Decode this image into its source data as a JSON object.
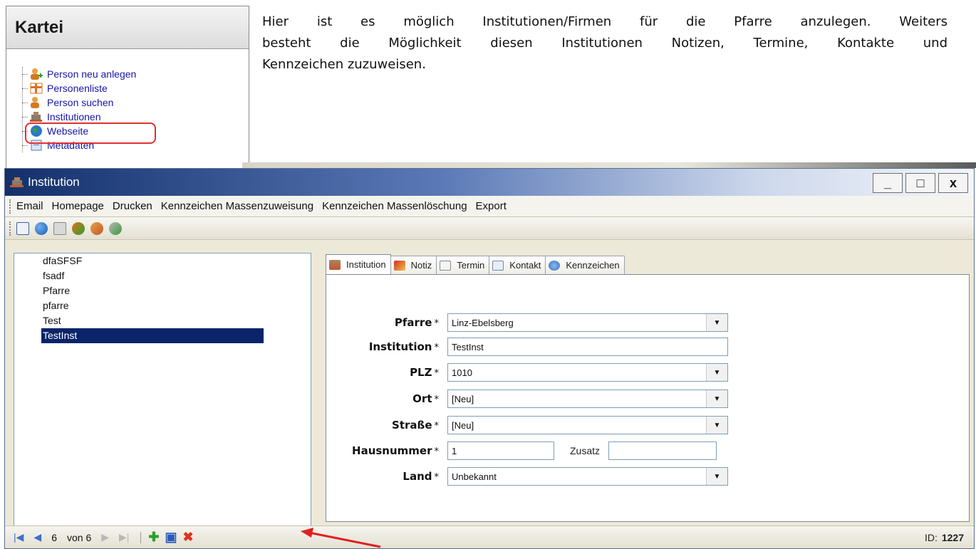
{
  "sidebar": {
    "title": "Kartei",
    "items": [
      {
        "label": "Person neu anlegen",
        "icon": "person-add-icon"
      },
      {
        "label": "Personenliste",
        "icon": "list-icon"
      },
      {
        "label": "Person suchen",
        "icon": "person-search-icon"
      },
      {
        "label": "Institutionen",
        "icon": "institution-icon"
      },
      {
        "label": "Webseite",
        "icon": "globe-icon"
      },
      {
        "label": "Metadaten",
        "icon": "metadata-icon"
      }
    ]
  },
  "intro": {
    "line1": "Hier ist es möglich Institutionen/Firmen für die Pfarre anzulegen. Weiters",
    "line2": "besteht die Möglichkeit diesen Institutionen Notizen, Termine, Kontakte und",
    "line3": "Kennzeichen zuzuweisen."
  },
  "window": {
    "title": "Institution",
    "buttons": {
      "minimize": "_",
      "maximize": "□",
      "close": "x"
    }
  },
  "menu": [
    "Email",
    "Homepage",
    "Drucken",
    "Kennzeichen Massenzuweisung",
    "Kennzeichen Massenlöschung",
    "Export"
  ],
  "list": {
    "items": [
      "dfaSFSF",
      "fsadf",
      "Pfarre",
      "pfarre",
      "Test",
      "TestInst"
    ],
    "selected": "TestInst"
  },
  "tabs": [
    "Institution",
    "Notiz",
    "Termin",
    "Kontakt",
    "Kennzeichen"
  ],
  "form": {
    "pfarre": {
      "label": "Pfarre",
      "value": "Linz-Ebelsberg"
    },
    "institution": {
      "label": "Institution",
      "value": "TestInst"
    },
    "plz": {
      "label": "PLZ",
      "value": "1010"
    },
    "ort": {
      "label": "Ort",
      "value": "[Neu]"
    },
    "strasse": {
      "label": "Straße",
      "value": "[Neu]"
    },
    "hausnummer": {
      "label": "Hausnummer",
      "value": "1"
    },
    "zusatz": {
      "label": "Zusatz",
      "value": ""
    },
    "land": {
      "label": "Land",
      "value": "Unbekannt"
    },
    "required_marker": "*"
  },
  "status": {
    "page": "6",
    "of": "von 6",
    "id_label": "ID:",
    "id_value": "1227"
  },
  "colors": {
    "accent_red": "#e23030",
    "selection": "#0a246a"
  }
}
